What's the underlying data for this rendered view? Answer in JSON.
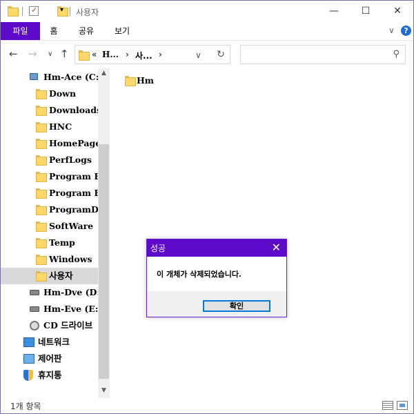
{
  "window": {
    "title": "사용자",
    "minimize": "—",
    "maximize": "☐",
    "close": "✕"
  },
  "ribbon": {
    "tabs": [
      "파일",
      "홈",
      "공유",
      "보기"
    ],
    "expand": "∨",
    "help": "?"
  },
  "nav": {
    "back": "←",
    "forward": "→",
    "recent": "∨",
    "up": "↑",
    "address": {
      "overflow": "«",
      "crumbs": [
        "H...",
        "사..."
      ],
      "chevron": "›",
      "dropdown": "∨",
      "refresh": "↻"
    },
    "search_icon": "⚲"
  },
  "tree": {
    "items": [
      {
        "label": "Hm-Ace (C:",
        "icon": "windows-drive-icon"
      },
      {
        "label": "Down",
        "icon": "folder-icon"
      },
      {
        "label": "Downloads",
        "icon": "folder-icon"
      },
      {
        "label": "HNC",
        "icon": "folder-icon"
      },
      {
        "label": "HomePage",
        "icon": "folder-icon"
      },
      {
        "label": "PerfLogs",
        "icon": "folder-icon"
      },
      {
        "label": "Program F",
        "icon": "folder-icon"
      },
      {
        "label": "Program F",
        "icon": "folder-icon"
      },
      {
        "label": "ProgramDa",
        "icon": "folder-icon"
      },
      {
        "label": "SoftWare",
        "icon": "folder-icon"
      },
      {
        "label": "Temp",
        "icon": "folder-icon"
      },
      {
        "label": "Windows",
        "icon": "folder-icon"
      },
      {
        "label": "사용자",
        "icon": "folder-icon",
        "selected": true
      },
      {
        "label": "Hm-Dve (D:",
        "icon": "drive-icon"
      },
      {
        "label": "Hm-Eve (E:",
        "icon": "drive-icon"
      },
      {
        "label": "CD 드라이브",
        "icon": "cd-drive-icon"
      },
      {
        "label": "네트워크",
        "icon": "network-icon"
      },
      {
        "label": "제어판",
        "icon": "control-panel-icon"
      },
      {
        "label": "휴지통",
        "icon": "recycle-bin-icon"
      }
    ],
    "scroll_up": "▲",
    "scroll_down": "▼"
  },
  "content": {
    "items": [
      {
        "label": "Hm",
        "icon": "folder-icon"
      }
    ]
  },
  "status": {
    "item_count": "1개 항목"
  },
  "dialog": {
    "title": "성공",
    "close": "✕",
    "message": "이 개체가 삭제되었습니다.",
    "ok_label": "확인"
  },
  "colors": {
    "accent": "#5c09c9",
    "selection": "#d9d9d9"
  }
}
